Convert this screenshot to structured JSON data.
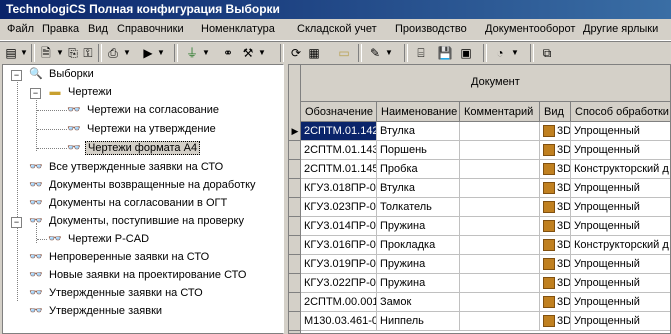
{
  "window": {
    "title": "TechnologiCS Полная конфигурация Выборки"
  },
  "menu": [
    "Файл",
    "Правка",
    "Вид",
    "Справочники",
    "Номенклатура",
    "Складской учет",
    "Производство",
    "Документооборот",
    "Другие ярлыки"
  ],
  "tree": {
    "root": "Выборки",
    "folder": "Чертежи",
    "folder_children": [
      "Чертежи на согласование",
      "Чертежи на утверждение",
      "Чертежи формата А4"
    ],
    "items_a": [
      "Все утвержденные заявки на СТО",
      "Документы возвращенные на доработку",
      "Документы на согласовании в ОГТ",
      "Документы, поступившие на проверку"
    ],
    "sub_item": "Чертежи P-CAD",
    "items_b": [
      "Непроверенные заявки на СТО",
      "Новые заявки на проектирование СТО",
      "Утвержденные заявки на СТО",
      "Утвержденные заявки"
    ]
  },
  "grid": {
    "group_header": "Документ",
    "columns": [
      "Обозначение",
      "Наименование",
      "Комментарий",
      "Вид",
      "Способ обработки"
    ],
    "rows": [
      [
        "2СПТМ.01.142",
        "Втулка",
        "",
        "3D",
        "Упрощенный"
      ],
      [
        "2СПТМ.01.143",
        "Поршень",
        "",
        "3D",
        "Упрощенный"
      ],
      [
        "2СПТМ.01.145",
        "Пробка",
        "",
        "3D",
        "Конструкторский д"
      ],
      [
        "КГУ3.018ПР-0",
        "Втулка",
        "",
        "3D",
        "Упрощенный"
      ],
      [
        "КГУ3.023ПР-0",
        "Толкатель",
        "",
        "3D",
        "Упрощенный"
      ],
      [
        "КГУ3.014ПР-0",
        "Пружина",
        "",
        "3D",
        "Упрощенный"
      ],
      [
        "КГУ3.016ПР-0",
        "Прокладка",
        "",
        "3D",
        "Конструкторский д"
      ],
      [
        "КГУ3.019ПР-0",
        "Пружина",
        "",
        "3D",
        "Упрощенный"
      ],
      [
        "КГУ3.022ПР-0",
        "Пружина",
        "",
        "3D",
        "Упрощенный"
      ],
      [
        "2СПТМ.00.001",
        "Замок",
        "",
        "3D",
        "Упрощенный"
      ],
      [
        "М130.03.461-0",
        "Ниппель",
        "",
        "3D",
        "Упрощенный"
      ]
    ]
  },
  "icons": {
    "vid": "3d-doc-icon"
  },
  "colors": {
    "title_start": "#0a246a",
    "title_end": "#3a6ea5",
    "selection": "#0a246a"
  }
}
